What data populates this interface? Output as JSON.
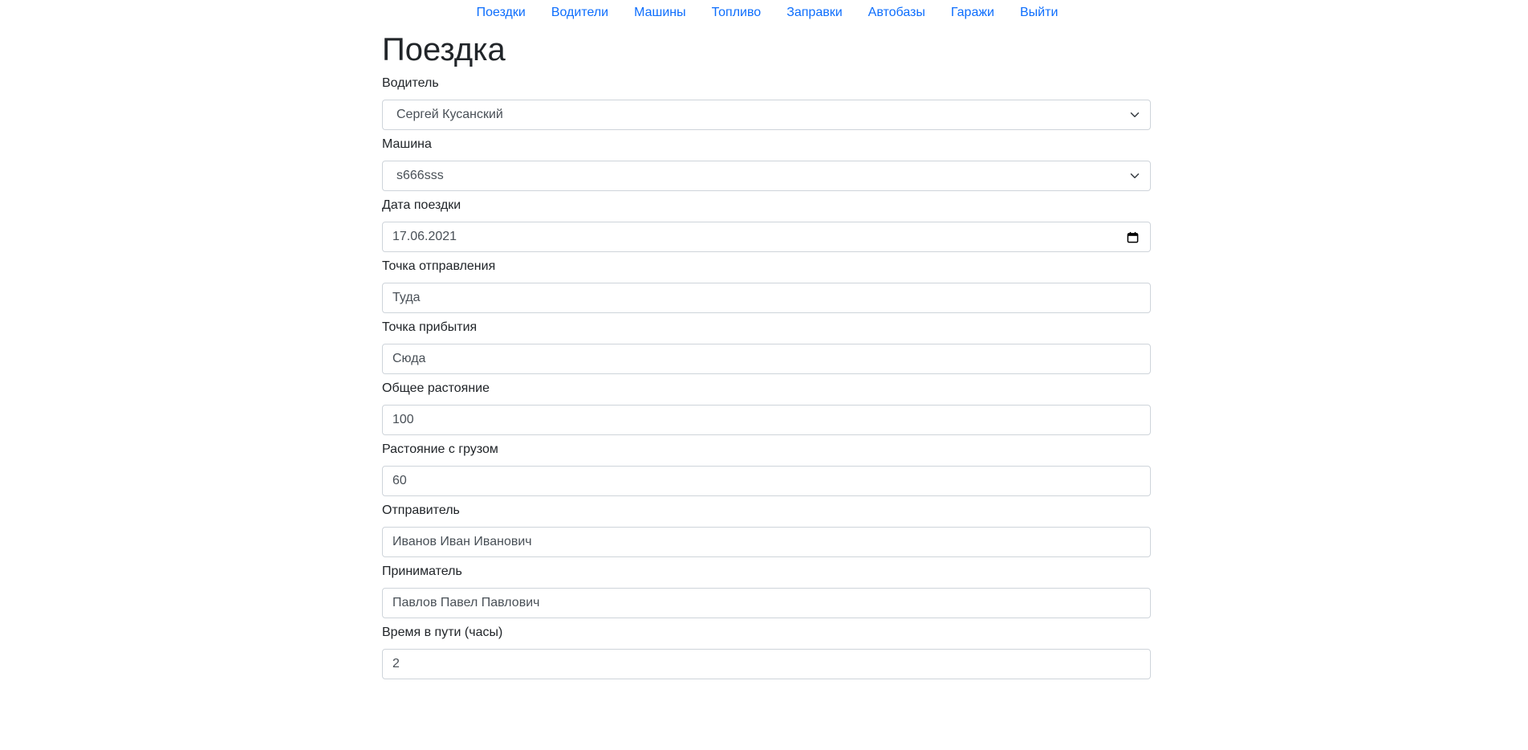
{
  "nav": {
    "items": [
      {
        "label": "Поездки"
      },
      {
        "label": "Водители"
      },
      {
        "label": "Машины"
      },
      {
        "label": "Топливо"
      },
      {
        "label": "Заправки"
      },
      {
        "label": "Автобазы"
      },
      {
        "label": "Гаражи"
      },
      {
        "label": "Выйти"
      }
    ]
  },
  "page": {
    "title": "Поездка"
  },
  "form": {
    "driver": {
      "label": "Водитель",
      "value": "Сергей Кусанский"
    },
    "car": {
      "label": "Машина",
      "value": "s666sss"
    },
    "date": {
      "label": "Дата поездки",
      "value": "17.06.2021"
    },
    "departure": {
      "label": "Точка отправления",
      "value": "Туда"
    },
    "arrival": {
      "label": "Точка прибытия",
      "value": "Сюда"
    },
    "distance": {
      "label": "Общее растояние",
      "value": "100"
    },
    "cargo_distance": {
      "label": "Растояние с грузом",
      "value": "60"
    },
    "sender": {
      "label": "Отправитель",
      "value": "Иванов Иван Иванович"
    },
    "receiver": {
      "label": "Приниматель",
      "value": "Павлов Павел Павлович"
    },
    "travel_time": {
      "label": "Время в пути (часы)",
      "value": "2"
    }
  },
  "colors": {
    "link": "#0d6efd",
    "text": "#212529",
    "input_text": "#495057",
    "border": "#ced4da"
  }
}
